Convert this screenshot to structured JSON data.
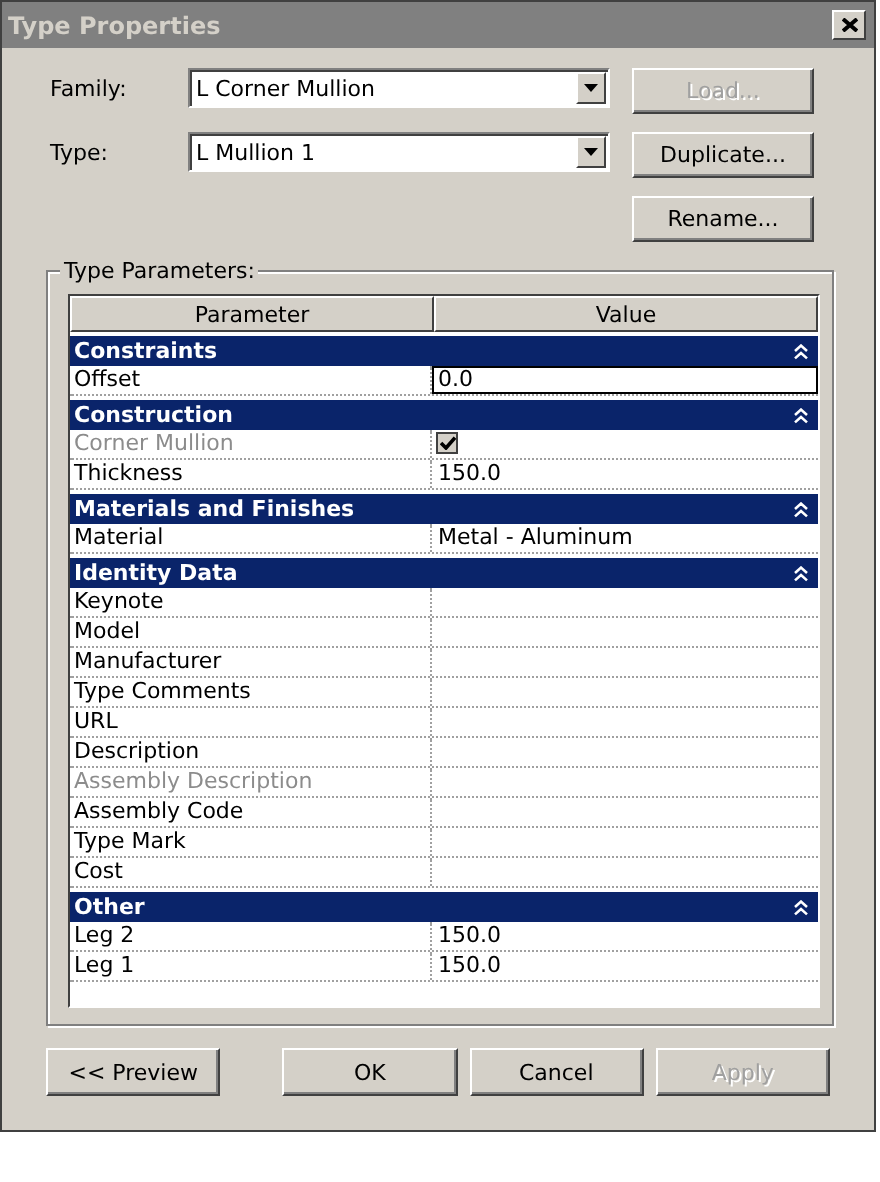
{
  "window": {
    "title": "Type Properties"
  },
  "fields": [
    {
      "label": "Family:",
      "value": "L Corner Mullion"
    },
    {
      "label": "Type:",
      "value": "L Mullion 1"
    }
  ],
  "side_buttons": [
    {
      "label": "Load...",
      "disabled": true
    },
    {
      "label": "Duplicate...",
      "disabled": false
    },
    {
      "label": "Rename...",
      "disabled": false
    }
  ],
  "group": {
    "title": "Type Parameters:",
    "columns": [
      "Parameter",
      "Value"
    ],
    "sections": [
      {
        "title": "Constraints",
        "expanded": true,
        "rows": [
          {
            "kind": "text",
            "name": "Offset",
            "value": "0.0",
            "editing": true,
            "disabled": false
          }
        ]
      },
      {
        "title": "Construction",
        "expanded": true,
        "rows": [
          {
            "kind": "checkbox",
            "name": "Corner Mullion",
            "checked": true,
            "disabled": true
          },
          {
            "kind": "text",
            "name": "Thickness",
            "value": "150.0",
            "editing": false,
            "disabled": false
          }
        ]
      },
      {
        "title": "Materials and Finishes",
        "expanded": true,
        "rows": [
          {
            "kind": "text",
            "name": "Material",
            "value": "Metal - Aluminum",
            "editing": false,
            "disabled": false
          }
        ]
      },
      {
        "title": "Identity Data",
        "expanded": true,
        "rows": [
          {
            "kind": "text",
            "name": "Keynote",
            "disabled": false
          },
          {
            "kind": "text",
            "name": "Model",
            "disabled": false
          },
          {
            "kind": "text",
            "name": "Manufacturer",
            "disabled": false
          },
          {
            "kind": "text",
            "name": "Type Comments",
            "disabled": false
          },
          {
            "kind": "text",
            "name": "URL",
            "disabled": false
          },
          {
            "kind": "text",
            "name": "Description",
            "disabled": false
          },
          {
            "kind": "text",
            "name": "Assembly Description",
            "disabled": true
          },
          {
            "kind": "text",
            "name": "Assembly Code",
            "disabled": false
          },
          {
            "kind": "text",
            "name": "Type Mark",
            "disabled": false
          },
          {
            "kind": "text",
            "name": "Cost",
            "disabled": false
          }
        ]
      },
      {
        "title": "Other",
        "expanded": true,
        "rows": [
          {
            "kind": "text",
            "name": "Leg 2",
            "value": "150.0",
            "editing": false,
            "disabled": false
          },
          {
            "kind": "text",
            "name": "Leg 1",
            "value": "150.0",
            "editing": false,
            "disabled": false
          }
        ]
      }
    ]
  },
  "bottom_buttons": [
    {
      "label": "<< Preview",
      "disabled": false
    },
    {
      "label": "OK",
      "disabled": false
    },
    {
      "label": "Cancel",
      "disabled": false
    },
    {
      "label": "Apply",
      "disabled": true
    }
  ]
}
